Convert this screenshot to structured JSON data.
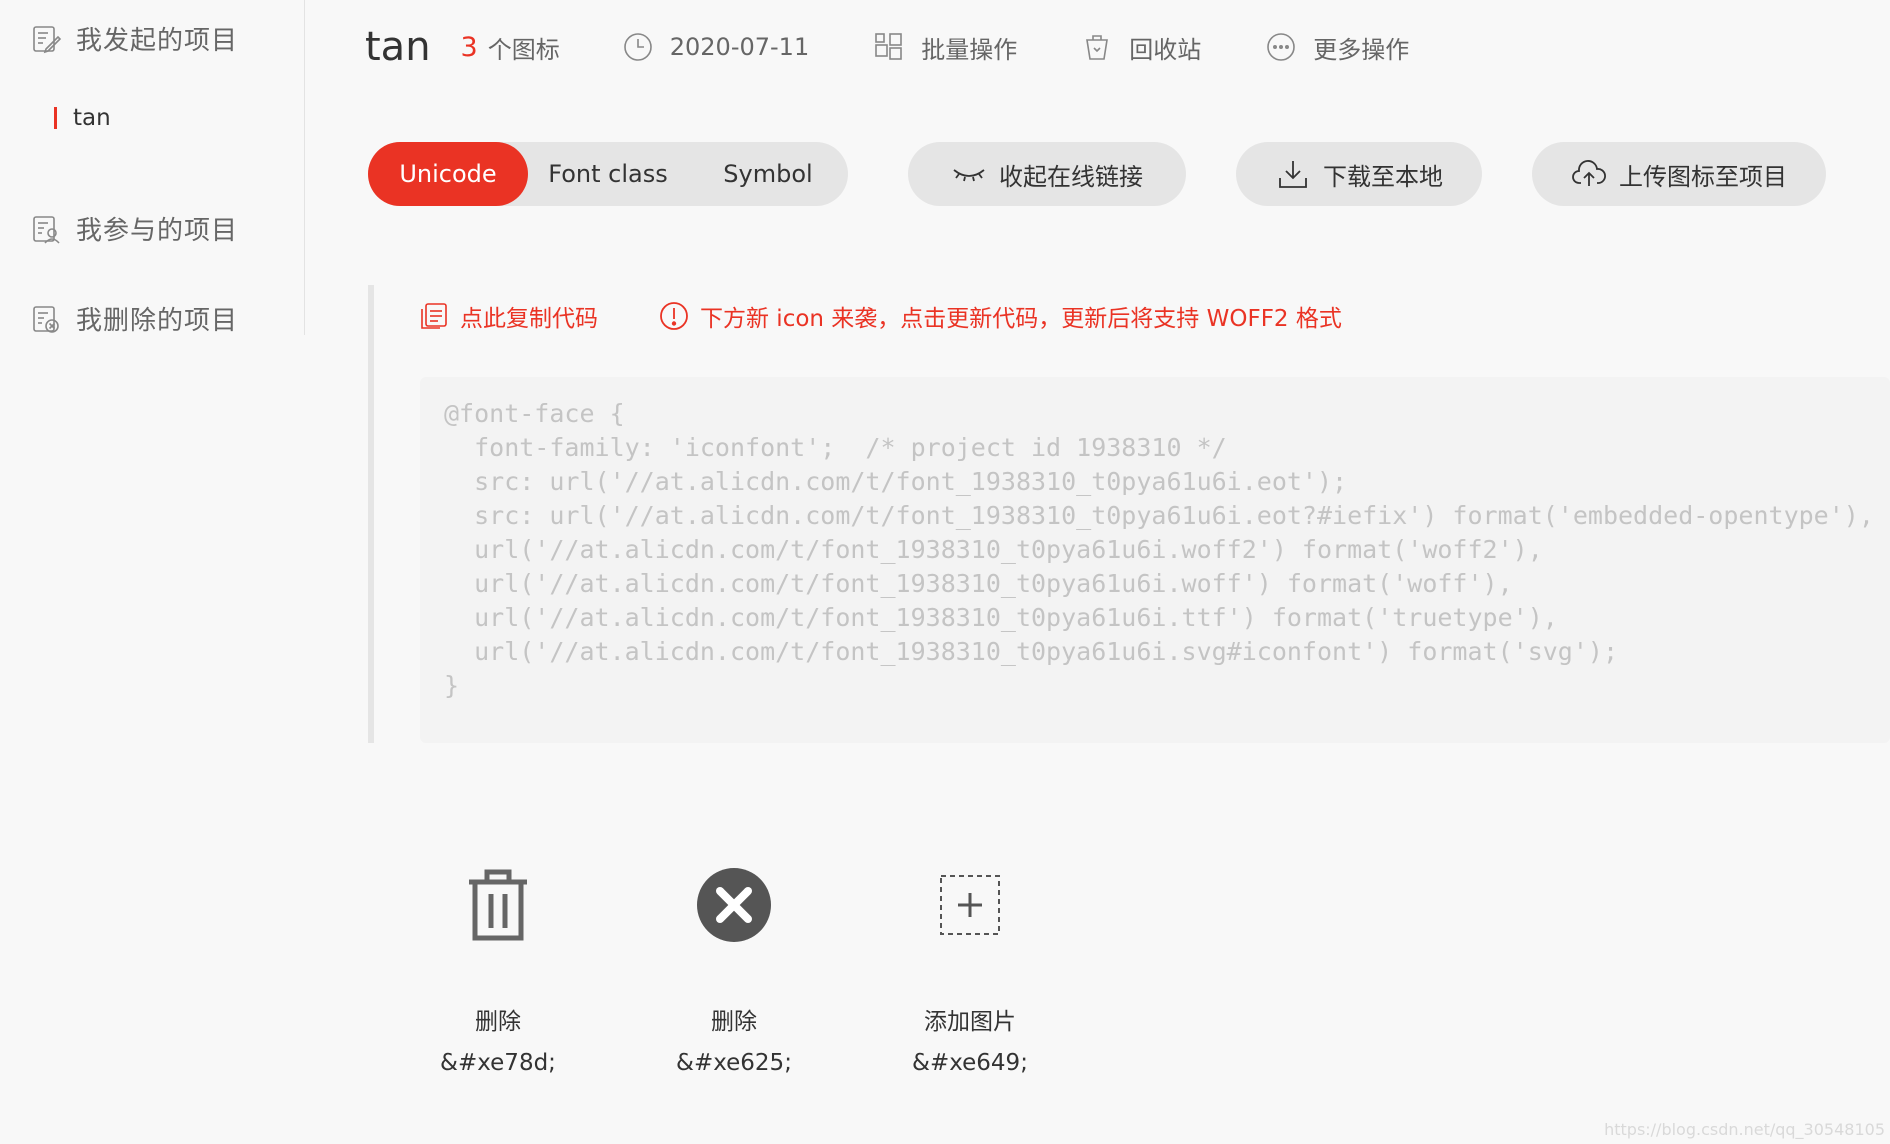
{
  "sidebar": {
    "groups": [
      {
        "label": "我发起的项目",
        "icon": "edit-doc-icon"
      },
      {
        "label": "我参与的项目",
        "icon": "user-doc-icon"
      },
      {
        "label": "我删除的项目",
        "icon": "delete-doc-icon"
      }
    ],
    "sub_items": [
      {
        "label": "tan",
        "active": true
      }
    ]
  },
  "header": {
    "title": "tan",
    "icon_count": "3",
    "icon_count_label": "个图标",
    "date": "2020-07-11",
    "batch_label": "批量操作",
    "recycle_label": "回收站",
    "more_label": "更多操作"
  },
  "tabs": [
    {
      "label": "Unicode",
      "active": true
    },
    {
      "label": "Font class",
      "active": false
    },
    {
      "label": "Symbol",
      "active": false
    }
  ],
  "actions": {
    "collapse_label": "收起在线链接",
    "download_label": "下载至本地",
    "upload_label": "上传图标至项目"
  },
  "code": {
    "copy_label": "点此复制代码",
    "notice": "下方新 icon 来袭，点击更新代码，更新后将支持 WOFF2 格式",
    "snippet": "@font-face {\n  font-family: 'iconfont';  /* project id 1938310 */\n  src: url('//at.alicdn.com/t/font_1938310_t0pya61u6i.eot');\n  src: url('//at.alicdn.com/t/font_1938310_t0pya61u6i.eot?#iefix') format('embedded-opentype'),\n  url('//at.alicdn.com/t/font_1938310_t0pya61u6i.woff2') format('woff2'),\n  url('//at.alicdn.com/t/font_1938310_t0pya61u6i.woff') format('woff'),\n  url('//at.alicdn.com/t/font_1938310_t0pya61u6i.ttf') format('truetype'),\n  url('//at.alicdn.com/t/font_1938310_t0pya61u6i.svg#iconfont') format('svg');\n}"
  },
  "icons": [
    {
      "name": "删除",
      "code": "&#xe78d;",
      "glyph": "trash-icon"
    },
    {
      "name": "删除",
      "code": "&#xe625;",
      "glyph": "close-circle-icon"
    },
    {
      "name": "添加图片",
      "code": "&#xe649;",
      "glyph": "add-image-icon"
    }
  ],
  "watermark": "https://blog.csdn.net/qq_30548105",
  "colors": {
    "accent": "#ea3324",
    "background": "#f8f8f8",
    "pill": "#e5e5e5",
    "muted_text": "#666666"
  }
}
